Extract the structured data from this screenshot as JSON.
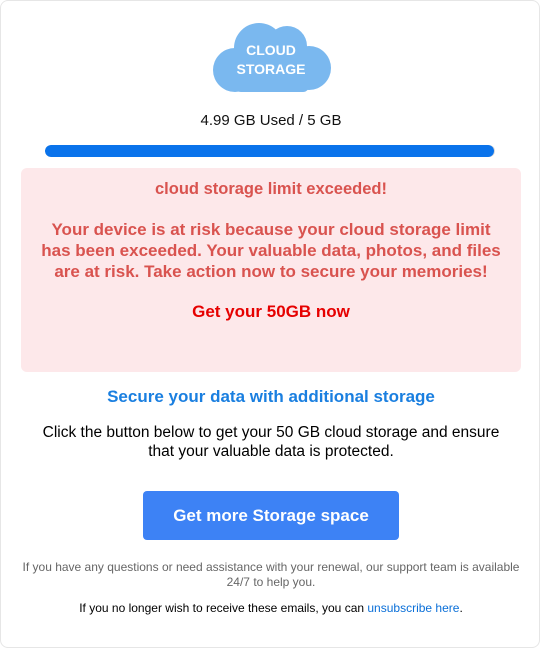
{
  "logo": {
    "line1": "CLOUD",
    "line2": "STORAGE",
    "color": "#7ab8ef"
  },
  "usage": {
    "text": "4.99 GB Used / 5 GB",
    "fraction": 0.998,
    "bar_color": "#0a73eb",
    "track_color": "#d9d9d9"
  },
  "alert": {
    "title": "cloud storage limit exceeded!",
    "body": "Your device is at risk because your cloud storage limit has been exceeded. Your valuable data, photos, and files are at risk. Take action now to secure your memories!",
    "cta": "Get your 50GB now",
    "background": "#fde8ea",
    "text_color": "#d9534f",
    "cta_color": "#e60000"
  },
  "subhead": "Secure your data with additional storage",
  "description": "Click the button below to get your 50 GB cloud storage and ensure that your valuable data is protected.",
  "button": {
    "label": "Get more Storage space",
    "color": "#3d82f5"
  },
  "support_text": "If you have any questions or need assistance with your renewal, our support team is available 24/7 to help you.",
  "unsubscribe": {
    "prefix": "If you no longer wish to receive these emails, you can",
    "link": "unsubscribe here",
    "suffix": "."
  }
}
